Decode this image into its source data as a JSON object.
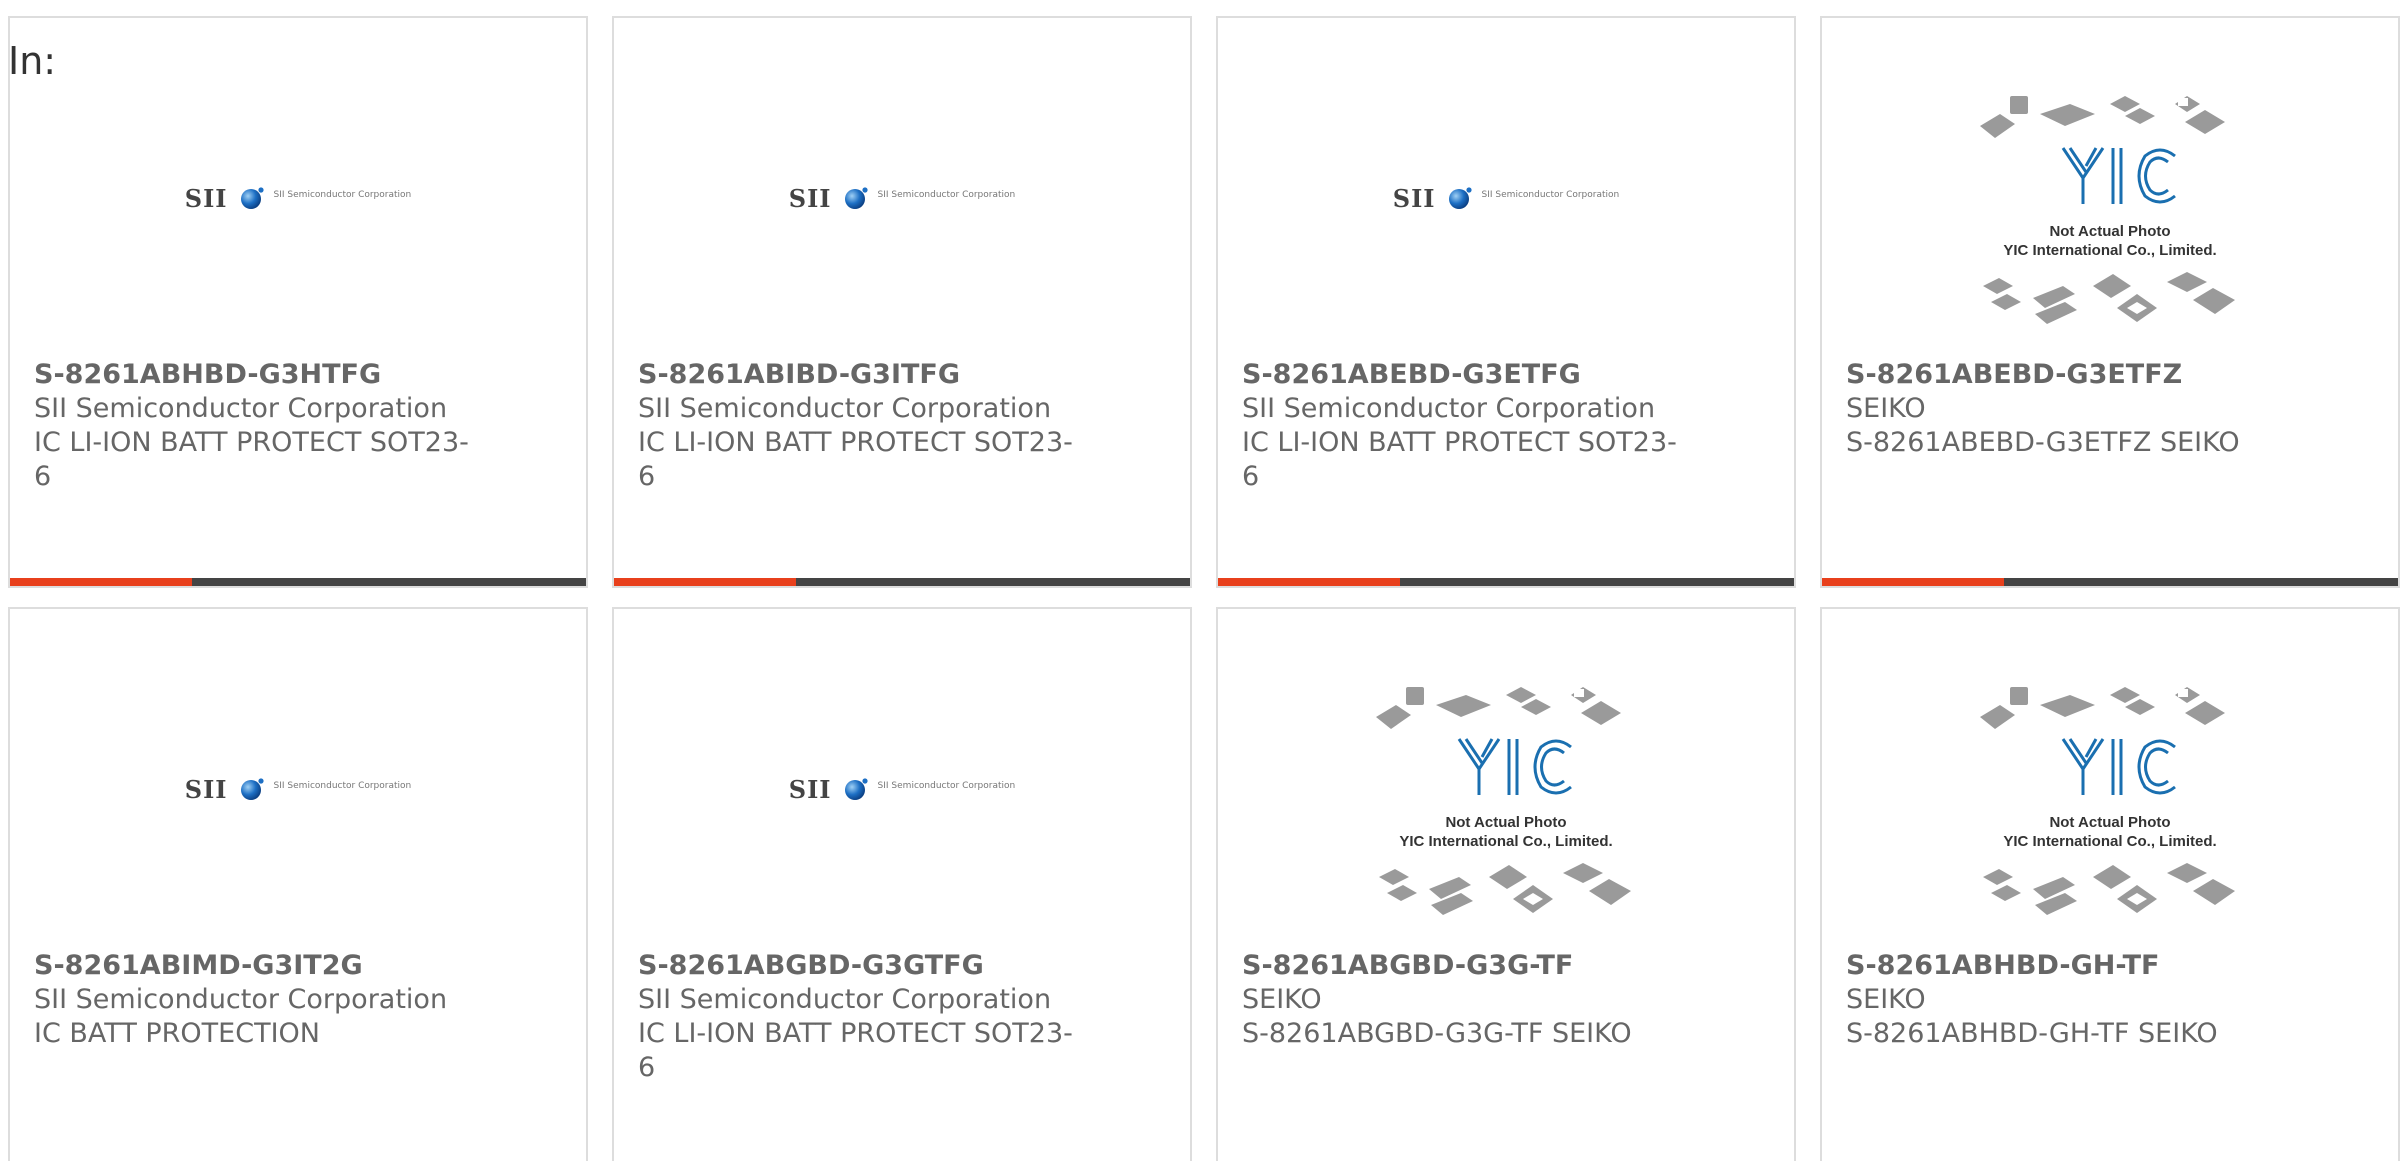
{
  "page": {
    "label": "In:"
  },
  "colors": {
    "accent": "#e8401c",
    "bar": "#444444",
    "text": "#666666",
    "border": "#dddddd",
    "yic_blue": "#1a6fb0"
  },
  "logos": {
    "sii": {
      "text": "SII",
      "corp": "SII Semiconductor Corporation",
      "icon": "globe-icon"
    },
    "yic": {
      "brand": "YIC",
      "line1": "Not Actual Photo",
      "line2": "YIC International Co., Limited."
    }
  },
  "products": [
    {
      "part": "S-8261ABHBD-G3HTFG",
      "manufacturer": "SII Semiconductor Corporation",
      "description": "IC LI-ION BATT PROTECT SOT23-6",
      "image": "sii-logo"
    },
    {
      "part": "S-8261ABIBD-G3ITFG",
      "manufacturer": "SII Semiconductor Corporation",
      "description": "IC LI-ION BATT PROTECT SOT23-6",
      "image": "sii-logo"
    },
    {
      "part": "S-8261ABEBD-G3ETFG",
      "manufacturer": "SII Semiconductor Corporation",
      "description": "IC LI-ION BATT PROTECT SOT23-6",
      "image": "sii-logo"
    },
    {
      "part": "S-8261ABEBD-G3ETFZ",
      "manufacturer": "SEIKO",
      "description": "S-8261ABEBD-G3ETFZ SEIKO",
      "image": "yic-placeholder"
    },
    {
      "part": "S-8261ABIMD-G3IT2G",
      "manufacturer": "SII Semiconductor Corporation",
      "description": "IC BATT PROTECTION",
      "image": "sii-logo"
    },
    {
      "part": "S-8261ABGBD-G3GTFG",
      "manufacturer": "SII Semiconductor Corporation",
      "description": "IC LI-ION BATT PROTECT SOT23-6",
      "image": "sii-logo"
    },
    {
      "part": "S-8261ABGBD-G3G-TF",
      "manufacturer": "SEIKO",
      "description": "S-8261ABGBD-G3G-TF SEIKO",
      "image": "yic-placeholder"
    },
    {
      "part": "S-8261ABHBD-GH-TF",
      "manufacturer": "SEIKO",
      "description": "S-8261ABHBD-GH-TF SEIKO",
      "image": "yic-placeholder"
    }
  ]
}
